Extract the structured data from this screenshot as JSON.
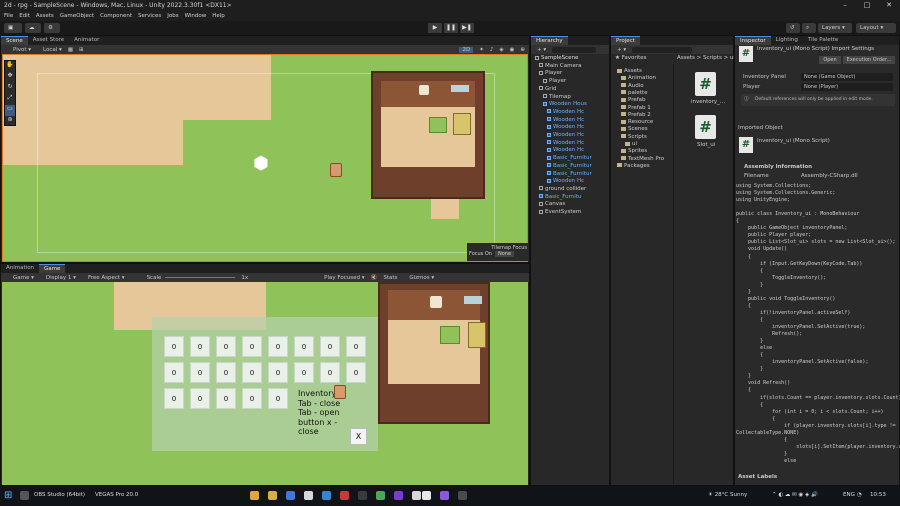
{
  "title": "2d - rpg - SampleScene - Windows, Mac, Linux - Unity 2022.3.30f1 <DX11>",
  "menu": [
    "File",
    "Edit",
    "Assets",
    "GameObject",
    "Component",
    "Services",
    "Jobs",
    "Window",
    "Help"
  ],
  "toolbar": {
    "layers": "Layers",
    "layout": "Layout"
  },
  "scene_panel": {
    "tabs": [
      "Scene",
      "Asset Store",
      "Animator"
    ],
    "pivot": "Pivot",
    "local": "Local",
    "mode_2d": "2D",
    "tilemap_focus": "Tilemap Focus",
    "focus_on_label": "Focus On",
    "focus_on_value": "None"
  },
  "game_panel": {
    "tabs": [
      "Animation",
      "Game"
    ],
    "game_dropdown": "Game",
    "display": "Display 1",
    "aspect": "Free Aspect",
    "scale_label": "Scale",
    "scale_value": "1x",
    "play_focused": "Play Focused",
    "stats": "Stats",
    "gizmos": "Gizmos",
    "slots": [
      "0",
      "0",
      "0",
      "0",
      "0",
      "0",
      "0",
      "0",
      "0",
      "0",
      "0",
      "0",
      "0",
      "0",
      "0",
      "0",
      "0",
      "0",
      "0",
      "0",
      "0"
    ],
    "inventory_text": [
      "Inventory",
      "Tab - close",
      "Tab - open",
      "button x -",
      "close"
    ],
    "close_button": "X"
  },
  "hierarchy": {
    "tab": "Hierarchy",
    "items": [
      {
        "label": "SampleScene",
        "style": "sel"
      },
      {
        "label": "Main Camera",
        "style": ""
      },
      {
        "label": "Player",
        "style": ""
      },
      {
        "label": "Player",
        "style": ""
      },
      {
        "label": "Grid",
        "style": ""
      },
      {
        "label": "Tilemap",
        "style": ""
      },
      {
        "label": "Wooden Hous",
        "style": "blue"
      },
      {
        "label": "Wooden Hc",
        "style": "blue"
      },
      {
        "label": "Wooden Hc",
        "style": "blue"
      },
      {
        "label": "Wooden Hc",
        "style": "blue"
      },
      {
        "label": "Wooden Hc",
        "style": "blue"
      },
      {
        "label": "Wooden Hc",
        "style": "blue"
      },
      {
        "label": "Wooden Hc",
        "style": "blue"
      },
      {
        "label": "Basic_Furnitur",
        "style": "blue"
      },
      {
        "label": "Basic_Furnitur",
        "style": "blue"
      },
      {
        "label": "Basic_Furnitur",
        "style": "blue"
      },
      {
        "label": "Wooden Hc",
        "style": "blue"
      },
      {
        "label": "ground collider",
        "style": ""
      },
      {
        "label": "Basic_Furnitu",
        "style": "blue"
      },
      {
        "label": "Canvas",
        "style": ""
      },
      {
        "label": "EventSystem",
        "style": ""
      }
    ]
  },
  "project": {
    "tab": "Project",
    "favorites": "Favorites",
    "breadcrumb": "Assets > Scripts > ui",
    "tree": [
      "Assets",
      "Animation",
      "Audio",
      "palette",
      "Prefab",
      "Prefab 1",
      "Prefab 2",
      "Resource",
      "Scenes",
      "Scripts",
      "ui",
      "Sprites",
      "TextMesh Pro",
      "Packages"
    ],
    "files": [
      "inventory_...",
      "Slot_ui"
    ]
  },
  "inspector": {
    "tabs": [
      "Inspector",
      "Lighting",
      "Tile Palette"
    ],
    "header": "Inventory_ui (Mono Script) Import Settings",
    "open": "Open",
    "execution_order": "Execution Order...",
    "inventory_panel_label": "Inventory Panel",
    "inventory_panel_value": "None (Game Object)",
    "player_label": "Player",
    "player_value": "None (Player)",
    "info": "Default references will only be applied in edit mode.",
    "imported_object": "Imported Object",
    "script_title": "Inventory_ui (Mono Script)",
    "assembly_info": "Assembly Information",
    "filename_label": "Filename",
    "filename_value": "Assembly-CSharp.dll",
    "code": [
      "using System.Collections;",
      "using System.Collections.Generic;",
      "using UnityEngine;",
      "",
      "public class Inventory_ui : MonoBehaviour",
      "{",
      "    public GameObject inventoryPanel;",
      "    public Player player;",
      "    public List<Slot_ui> slots = new List<Slot_ui>();",
      "    void Update()",
      "    {",
      "        if (Input.GetKeyDown(KeyCode.Tab))",
      "        {",
      "            ToggleInventory();",
      "        }",
      "    }",
      "    public void ToggleInventory()",
      "    {",
      "        if(!inventoryPanel.activeSelf)",
      "        {",
      "            inventoryPanel.SetActive(true);",
      "            Refresh();",
      "        }",
      "        else",
      "        {",
      "            inventoryPanel.SetActive(false);",
      "        }",
      "    }",
      "    void Refresh()",
      "    {",
      "        if(slots.Count == player.inventory.slots.Count)",
      "        {",
      "            for (int i = 0; i < slots.Count; i++)",
      "            {",
      "                if (player.inventory.slots[i].type !=",
      "CollectableType.NONE)",
      "                {",
      "                    slots[i].SetItem(player.inventory.slots[i]);",
      "                }",
      "                else"
    ],
    "asset_labels": "Asset Labels"
  },
  "taskbar": {
    "obs": "OBS Studio (64bit)",
    "vegas": "VEGAS Pro 20.0",
    "weather": "28°C  Sunny",
    "lang": "ENG",
    "time": "10:53"
  }
}
